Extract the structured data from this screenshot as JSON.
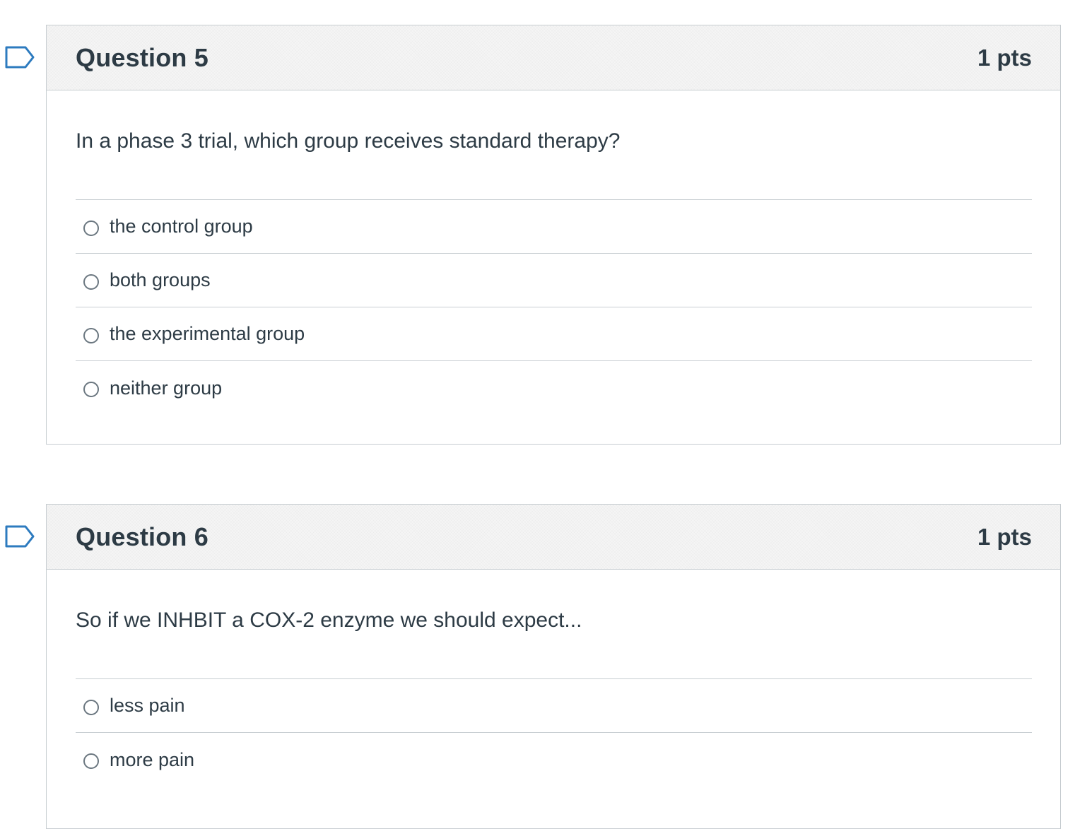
{
  "questions": [
    {
      "title": "Question 5",
      "points": "1 pts",
      "text": "In a phase 3 trial, which group receives standard therapy?",
      "answers": [
        "the control group",
        "both groups",
        "the experimental group",
        "neither group"
      ]
    },
    {
      "title": "Question 6",
      "points": "1 pts",
      "text": "So if we INHBIT a COX-2 enzyme we should expect...",
      "answers": [
        "less pain",
        "more pain"
      ]
    }
  ],
  "icons": {
    "flag": "bookmark-flag-icon",
    "radio": "radio-unselected-icon"
  },
  "colors": {
    "text": "#2d3b45",
    "border": "#c7cdd1",
    "header_bg": "#f5f5f5",
    "flag_stroke": "#2d7bbf"
  }
}
